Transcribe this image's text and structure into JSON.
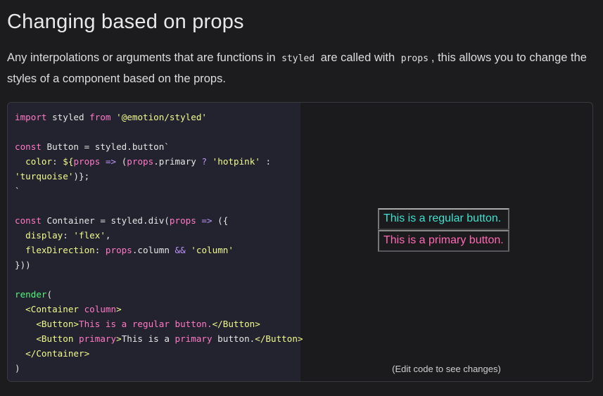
{
  "heading": "Changing based on props",
  "description": {
    "part1": "Any interpolations or arguments that are functions in",
    "code1": "styled",
    "part2": "are called with",
    "code2": "props",
    "part3": ", this allows you to change the styles of a component based on the props."
  },
  "code_lines": [
    "import styled from '@emotion/styled'",
    "",
    "const Button = styled.button`",
    "  color: ${props => (props.primary ? 'hotpink' :",
    "'turquoise')};",
    "`",
    "",
    "const Container = styled.div(props => ({",
    "  display: 'flex',",
    "  flexDirection: props.column && 'column'",
    "}))",
    "",
    "render(",
    "  <Container column>",
    "    <Button>This is a regular button.</Button>",
    "    <Button primary>This is a primary button.</Button>",
    "  </Container>",
    ")"
  ],
  "preview": {
    "regular_label": "This is a regular button.",
    "primary_label": "This is a primary button.",
    "regular_color": "#40e0d0",
    "primary_color": "#ff69b4",
    "hint": "(Edit code to see changes)"
  }
}
